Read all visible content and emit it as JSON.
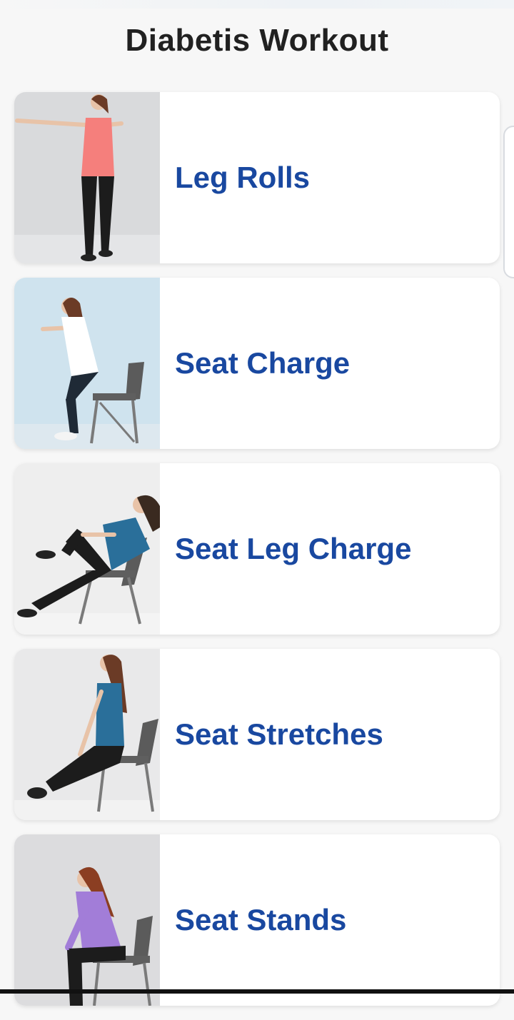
{
  "header": {
    "title": "Diabetis Workout"
  },
  "exercises": [
    {
      "label": "Leg Rolls",
      "image": "woman-standing-arms-out-icon"
    },
    {
      "label": "Seat Charge",
      "image": "woman-squat-chair-icon"
    },
    {
      "label": "Seat Leg Charge",
      "image": "woman-seated-knee-hug-icon"
    },
    {
      "label": "Seat Stretches",
      "image": "woman-seated-leg-stretch-icon"
    },
    {
      "label": "Seat Stands",
      "image": "woman-sit-to-stand-icon"
    }
  ],
  "colors": {
    "background": "#f7f7f7",
    "card": "#ffffff",
    "title_text": "#212121",
    "label_text": "#1948a0"
  }
}
